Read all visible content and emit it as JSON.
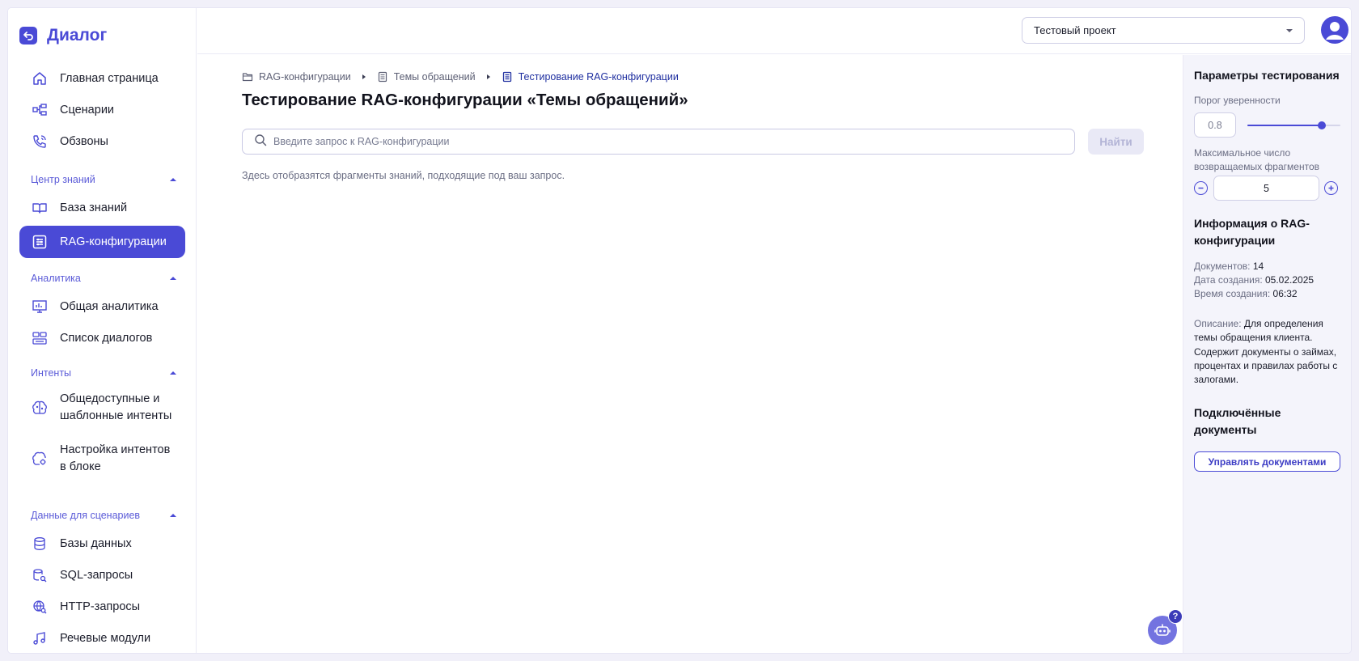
{
  "app": {
    "name": "Диалог"
  },
  "sidebar": {
    "items": [
      {
        "label": "Главная страница",
        "icon": "home-icon"
      },
      {
        "label": "Сценарии",
        "icon": "scenario-icon"
      },
      {
        "label": "Обзвоны",
        "icon": "phone-icon"
      },
      {
        "label": "База знаний",
        "icon": "book-icon"
      },
      {
        "label": "RAG-конфигурации",
        "icon": "settings-list-icon",
        "active": true
      },
      {
        "label": "Общая аналитика",
        "icon": "analytics-icon"
      },
      {
        "label": "Список диалогов",
        "icon": "dialogs-list-icon"
      },
      {
        "label": "Общедоступные и шаблонные интенты",
        "icon": "brain-icon"
      },
      {
        "label": "Настройка интентов в блоке",
        "icon": "brain-gear-icon"
      },
      {
        "label": "Базы данных",
        "icon": "database-icon"
      },
      {
        "label": "SQL-запросы",
        "icon": "sql-icon"
      },
      {
        "label": "HTTP-запросы",
        "icon": "http-icon"
      },
      {
        "label": "Речевые модули",
        "icon": "music-icon"
      }
    ],
    "sections": [
      {
        "label": "Центр знаний"
      },
      {
        "label": "Аналитика"
      },
      {
        "label": "Интенты"
      },
      {
        "label": "Данные для сценариев"
      }
    ]
  },
  "header": {
    "project": "Тестовый проект",
    "avatar_icon": "user-avatar-icon"
  },
  "breadcrumb": [
    {
      "label": "RAG-конфигурации",
      "icon": "folder-icon"
    },
    {
      "label": "Темы обращений",
      "icon": "document-icon"
    },
    {
      "label": "Тестирование RAG-конфигурации",
      "icon": "document-icon"
    }
  ],
  "main": {
    "title": "Тестирование RAG-конфигурации «Темы обращений»",
    "search_placeholder": "Введите запрос к RAG-конфигурации",
    "search_button": "Найти",
    "hint": "Здесь отобразятся фрагменты знаний, подходящие под ваш запрос."
  },
  "help": {
    "badge": "?"
  },
  "panel": {
    "params_title": "Параметры тестирования",
    "threshold_label": "Порог уверенности",
    "threshold_value": "0.8",
    "threshold_fraction": 0.8,
    "max_label": "Максимальное число возвращаемых фрагментов",
    "max_value": "5",
    "info_title": "Информация о RAG-конфигурации",
    "docs_key": "Документов:",
    "docs_value": "14",
    "date_key": "Дата создания:",
    "date_value": "05.02.2025",
    "time_key": "Время создания:",
    "time_value": "06:32",
    "desc_key": "Описание:",
    "desc_value": "Для определения темы обращения клиента. Содержит документы о займах, процентах и правилах работы с залогами.",
    "connected_title": "Подключённые документы",
    "manage_button": "Управлять документами"
  },
  "colors": {
    "accent": "#4a4ad6",
    "accent_dark": "#1f2fa0",
    "panel_bg": "#f4f4fb"
  }
}
